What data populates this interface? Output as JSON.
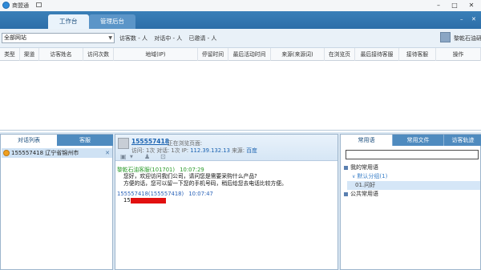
{
  "app": {
    "title": "商盟通"
  },
  "window_controls": {
    "minimize": "–",
    "maximize": "□",
    "close": "✕"
  },
  "tabs": [
    {
      "label": "工作台",
      "active": true
    },
    {
      "label": "管理后台",
      "active": false
    }
  ],
  "top_right_controls": {
    "minimize": "–",
    "close": "✕"
  },
  "toolbar": {
    "site_select": "全部网站",
    "visitors_count": "访客数 - 人",
    "chatting_count": "对话中 - 人",
    "invited_count": "已邀请 - 人",
    "agent_name": "黎乾石油研"
  },
  "table": {
    "headers": [
      "类型",
      "渠道",
      "访客姓名",
      "访问次数",
      "地域(IP)",
      "停留时间",
      "最后活动时间",
      "来源(来源词)",
      "在浏览页",
      "最后接待客服",
      "接待客服",
      "操作"
    ]
  },
  "left_panel": {
    "tabs": [
      {
        "label": "对话列表",
        "active": true
      },
      {
        "label": "客服",
        "active": false
      }
    ],
    "visitors": [
      {
        "label": "155557418 辽宁省锦州市",
        "close": "✕"
      }
    ]
  },
  "chat": {
    "visitor_id": "155557418",
    "browsing_label": "正在浏览页面:",
    "info_prefix": "访问: 1次 对话: 1次 IP:",
    "ip": "112.39.132.13",
    "source_label": "来源:",
    "source": "百度",
    "messages": [
      {
        "sender": "黎乾石油客服(101701)",
        "time": "10:07:29",
        "lines": [
          "您好，欢迎访问我们公司，请问您是需要采购什么产品?",
          "方便的话，您可以留一下您的手机号码，稍后给您去电话比较方便。"
        ]
      },
      {
        "sender": "155557418(155557418)",
        "time": "10:07:47",
        "lines": [
          "15"
        ]
      }
    ]
  },
  "right_panel": {
    "tabs": [
      {
        "label": "常用语",
        "active": true
      },
      {
        "label": "常用文件",
        "active": false
      },
      {
        "label": "访客轨迹",
        "active": false
      }
    ],
    "tree": [
      {
        "label": "我的常用语",
        "level": 0
      },
      {
        "label": "默认分组(1)",
        "level": 1
      },
      {
        "label": "01.问好",
        "level": 2
      },
      {
        "label": "公共常用语",
        "level": 0
      }
    ]
  },
  "icons": {
    "app": "app-logo-icon",
    "agent": "avatar-icon",
    "folder": "folder-icon",
    "person": "person-icon",
    "lock": "lock-icon"
  }
}
